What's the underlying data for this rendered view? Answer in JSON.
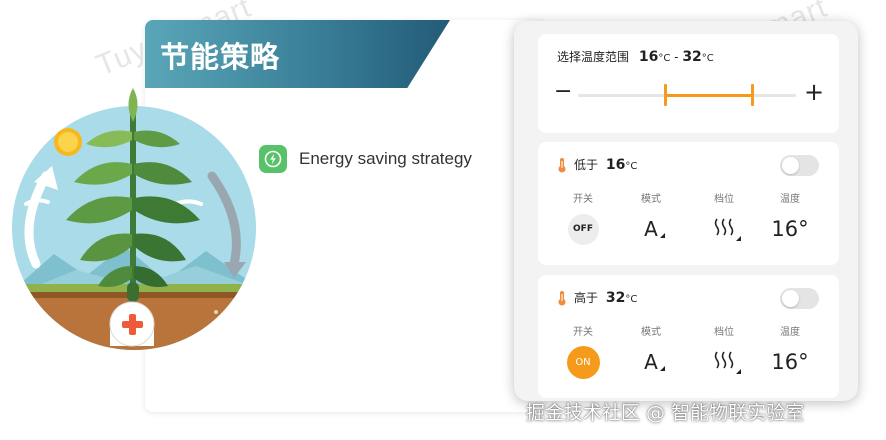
{
  "watermark": {
    "text": "Tuya Smart"
  },
  "left_card": {
    "title": "节能策略",
    "strategy_label": "Energy saving strategy"
  },
  "range": {
    "prefix": "选择温度范围",
    "low": "16",
    "sep": "-",
    "high": "32",
    "unit": "°C",
    "minus": "−",
    "plus": "+",
    "scale_min": 0,
    "scale_max": 40
  },
  "rules": [
    {
      "title": "低于",
      "temp": "16",
      "unit": "°C",
      "col_labels": [
        "开关",
        "模式",
        "档位",
        "温度"
      ],
      "switch": "OFF",
      "switch_on": false,
      "mode": "A",
      "temperature": "16°"
    },
    {
      "title": "高于",
      "temp": "32",
      "unit": "°C",
      "col_labels": [
        "开关",
        "模式",
        "档位",
        "温度"
      ],
      "switch": "ON",
      "switch_on": true,
      "mode": "A",
      "temperature": "16°"
    }
  ],
  "footer": "掘金技术社区 @ 智能物联实验室",
  "colors": {
    "accent": "#f59a1b",
    "banner_start": "#5aa6b8",
    "banner_end": "#235b77",
    "strategy_icon": "#58c26a"
  }
}
